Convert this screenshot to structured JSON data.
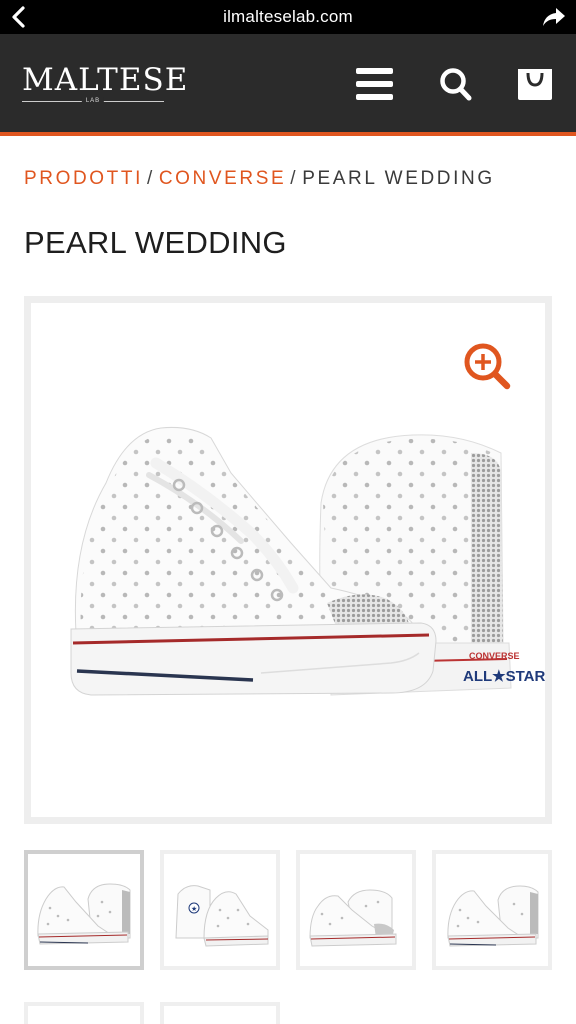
{
  "browser": {
    "url": "ilmalteselab.com",
    "back_icon": "chevron-left-icon",
    "share_icon": "share-arrow-icon"
  },
  "header": {
    "logo_text": "MALTESE",
    "logo_sub": "LAB",
    "menu_icon": "hamburger-icon",
    "search_icon": "search-icon",
    "cart_icon": "shopping-bag-icon"
  },
  "breadcrumb": {
    "items": [
      "PRODOTTI",
      "CONVERSE"
    ],
    "current": "PEARL WEDDING",
    "separator": "/"
  },
  "product": {
    "title": "PEARL WEDDING",
    "zoom_icon": "zoom-in-icon",
    "image_description_icon": "sneaker-image"
  },
  "thumbnails": {
    "count_visible": 4,
    "active_index": 0
  },
  "colors": {
    "accent": "#e0561f",
    "header_bg": "#2b2b2b",
    "frame_border": "#eeeeee"
  }
}
